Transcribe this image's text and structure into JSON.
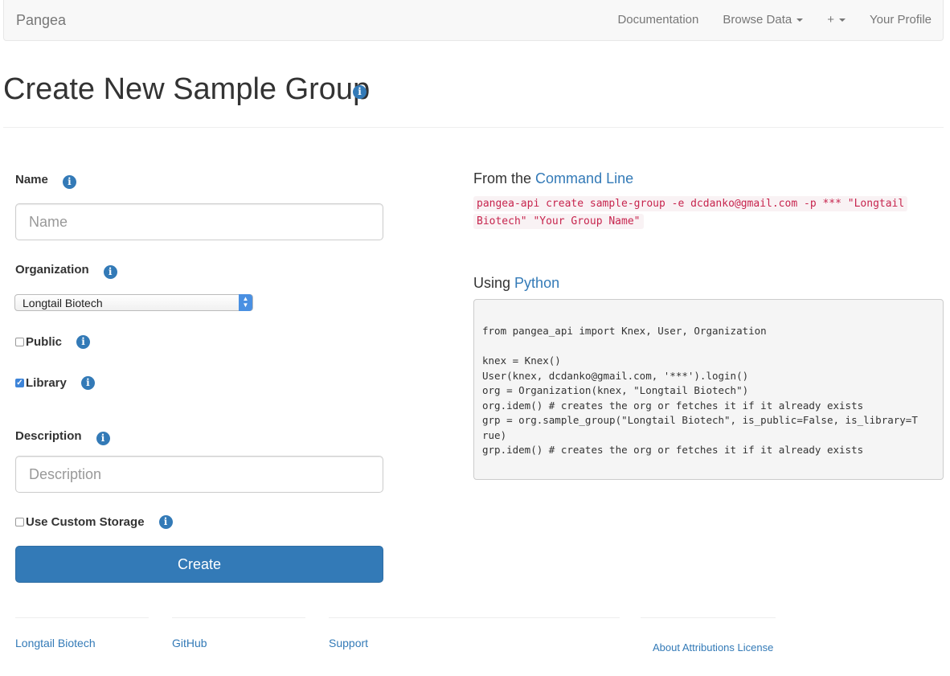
{
  "navbar": {
    "brand": "Pangea",
    "items": [
      "Documentation",
      "Browse Data",
      "+",
      "Your Profile"
    ]
  },
  "page": {
    "title": "Create New Sample Group"
  },
  "form": {
    "name_label": "Name",
    "name_placeholder": "Name",
    "organization_label": "Organization",
    "organization_selected": "Longtail Biotech",
    "public_label": "Public",
    "public_checked": false,
    "library_label": "Library",
    "library_checked": true,
    "description_label": "Description",
    "description_placeholder": "Description",
    "custom_storage_label": "Use Custom Storage",
    "custom_storage_checked": false,
    "create_label": "Create"
  },
  "cli": {
    "heading_prefix": "From the",
    "heading_link": "Command Line",
    "command": "pangea-api create sample-group -e dcdanko@gmail.com -p *** \"Longtail Biotech\" \"Your Group Name\""
  },
  "python": {
    "heading_prefix": "Using",
    "heading_link": "Python",
    "code": "from pangea_api import Knex, User, Organization\n\nknex = Knex()\nUser(knex, dcdanko@gmail.com, '***').login()\norg = Organization(knex, \"Longtail Biotech\")\norg.idem() # creates the org or fetches it if it already exists\ngrp = org.sample_group(\"Longtail Biotech\", is_public=False, is_library=T\nrue)\ngrp.idem() # creates the org or fetches it if it already exists"
  },
  "footer": {
    "links": [
      "Longtail Biotech",
      "GitHub",
      "Support",
      "About Attributions License"
    ]
  },
  "colors": {
    "link": "#337ab7",
    "primary_button": "#337ab7",
    "code_text": "#c7254e"
  }
}
